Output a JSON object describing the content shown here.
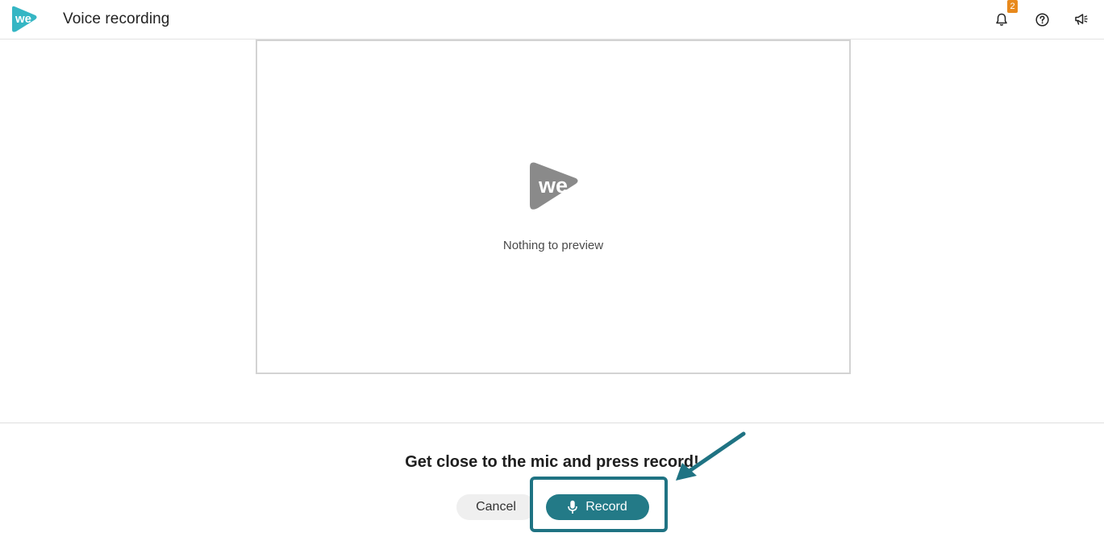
{
  "header": {
    "title": "Voice recording",
    "logo_text": "we",
    "notification_count": "2",
    "icons": [
      "bell-icon",
      "help-icon",
      "announcement-icon"
    ]
  },
  "preview": {
    "logo_text": "we",
    "empty_message": "Nothing to preview"
  },
  "footer": {
    "prompt": "Get close to the mic and press record!",
    "cancel_label": "Cancel",
    "record_label": "Record"
  },
  "colors": {
    "brand": "#35b6c4",
    "record_button": "#237a87",
    "highlight": "#1f7383",
    "badge": "#e8891c",
    "preview_logo": "#8a8a8a"
  }
}
